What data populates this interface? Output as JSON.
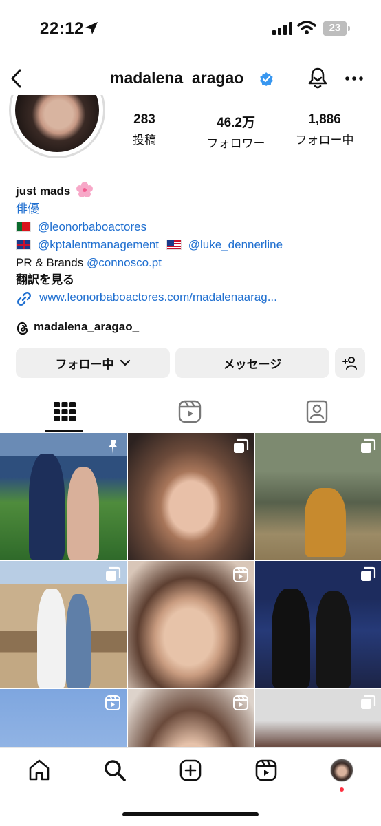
{
  "status_bar": {
    "time": "22:12",
    "battery": "23"
  },
  "header": {
    "username": "madalena_aragao_",
    "verified": true
  },
  "stats": [
    {
      "value": "283",
      "label": "投稿"
    },
    {
      "value": "46.2万",
      "label": "フォロワー"
    },
    {
      "value": "1,886",
      "label": "フォロー中"
    }
  ],
  "bio": {
    "name": "just mads",
    "category": "俳優",
    "line1_link": "@leonorbaboactores",
    "line2_link1": "@kptalentmanagement",
    "line2_link2": "@luke_dennerline",
    "line3_text": "PR & Brands",
    "line3_link": "@connosco.pt",
    "translate": "翻訳を見る",
    "url": "www.leonorbaboactores.com/madalenaarag...",
    "threads": "madalena_aragao_"
  },
  "buttons": {
    "follow": "フォロー中",
    "message": "メッセージ"
  },
  "colors": {
    "link": "#1f6fd0",
    "verified": "#3897f0",
    "button_bg": "#efefef",
    "notification_dot": "#ff3040"
  },
  "icons": {
    "tabs": [
      "grid-icon",
      "reels-icon",
      "tagged-icon"
    ],
    "nav": [
      "home-icon",
      "search-icon",
      "create-icon",
      "reels-icon",
      "profile-avatar"
    ]
  }
}
